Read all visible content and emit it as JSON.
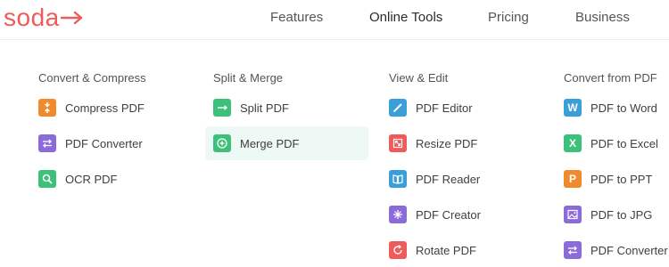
{
  "brand": {
    "name": "soda"
  },
  "nav": {
    "features": "Features",
    "online_tools": "Online Tools",
    "pricing": "Pricing",
    "business": "Business"
  },
  "menu": {
    "convert_compress": {
      "title": "Convert & Compress",
      "items": [
        {
          "label": "Compress PDF",
          "icon": "compress-icon",
          "color": "#f08a2c"
        },
        {
          "label": "PDF Converter",
          "icon": "convert-icon",
          "color": "#8b6bd9"
        },
        {
          "label": "OCR PDF",
          "icon": "ocr-search-icon",
          "color": "#3cc07a"
        }
      ]
    },
    "split_merge": {
      "title": "Split & Merge",
      "items": [
        {
          "label": "Split PDF",
          "icon": "split-icon",
          "color": "#3cc07a"
        },
        {
          "label": "Merge PDF",
          "icon": "merge-icon",
          "color": "#3cc07a",
          "highlighted": true
        }
      ]
    },
    "view_edit": {
      "title": "View & Edit",
      "items": [
        {
          "label": "PDF Editor",
          "icon": "pencil-icon",
          "color": "#3a9fd8"
        },
        {
          "label": "Resize PDF",
          "icon": "resize-icon",
          "color": "#ef5b5b"
        },
        {
          "label": "PDF Reader",
          "icon": "book-icon",
          "color": "#3a9fd8"
        },
        {
          "label": "PDF Creator",
          "icon": "sparkle-icon",
          "color": "#8b6bd9"
        },
        {
          "label": "Rotate PDF",
          "icon": "rotate-icon",
          "color": "#ef5b5b"
        }
      ]
    },
    "convert_from_pdf": {
      "title": "Convert from PDF",
      "items": [
        {
          "label": "PDF to Word",
          "icon": "word-icon",
          "letter": "W",
          "color": "#3a9fd8"
        },
        {
          "label": "PDF to Excel",
          "icon": "excel-icon",
          "letter": "X",
          "color": "#3cc07a"
        },
        {
          "label": "PDF to PPT",
          "icon": "ppt-icon",
          "letter": "P",
          "color": "#f08a2c"
        },
        {
          "label": "PDF to JPG",
          "icon": "image-icon",
          "color": "#8b6bd9"
        },
        {
          "label": "PDF Converter",
          "icon": "convert-icon",
          "color": "#8b6bd9"
        }
      ]
    }
  }
}
